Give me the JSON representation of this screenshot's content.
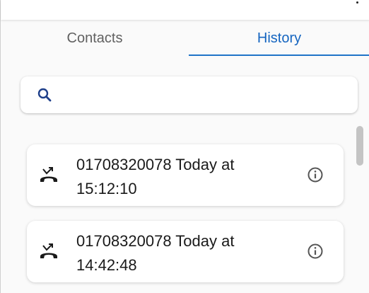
{
  "tabs": [
    {
      "label": "Contacts",
      "selected": false
    },
    {
      "label": "History",
      "selected": true
    }
  ],
  "colors": {
    "accent": "#1565c0",
    "tab_inactive": "#616161"
  },
  "search": {
    "icon": "search-icon",
    "value": "",
    "placeholder": ""
  },
  "history": [
    {
      "text": "01708320078 Today at 15:12:10",
      "icon": "missed-call-icon",
      "action_icon": "info-icon"
    },
    {
      "text": "01708320078 Today at 14:42:48",
      "icon": "missed-call-icon",
      "action_icon": "info-icon"
    }
  ]
}
